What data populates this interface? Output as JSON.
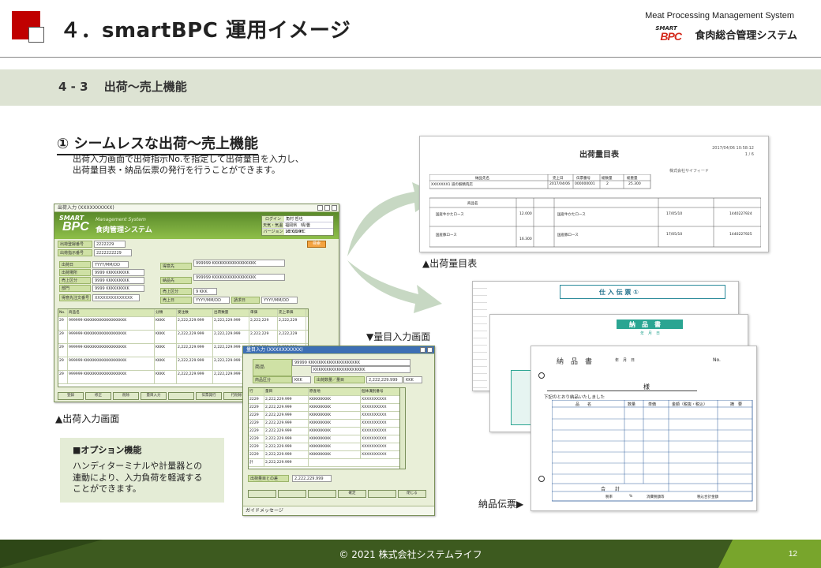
{
  "header": {
    "title": "４．smartBPC 運用イメージ",
    "system_en": "Meat Processing Management System",
    "brand_small": "SMART",
    "brand_bpc": "BPC",
    "brand_jp": "食肉総合管理システム"
  },
  "section": {
    "title": "4 - 3　 出荷〜売上機能"
  },
  "feature": {
    "title": "① シームレスな出荷〜売上機能",
    "desc": "出荷入力画面で出荷指示No.を指定して出荷量目を入力し、\n出荷量目表・納品伝票の発行を行うことができます。"
  },
  "captions": {
    "shipping_screen": "▲出荷入力画面",
    "quantity_screen": "▼量目入力画面",
    "weight_list": "▲出荷量目表",
    "delivery_slip": "納品伝票▶"
  },
  "option": {
    "title": "■オプション機能",
    "desc": "ハンディターミナルや計量器との\n連動により、入力負荷を軽減する\nことができます。"
  },
  "shipping_window": {
    "title": "出荷入力 (XXXXXXXXXX)",
    "brand_small": "SMART",
    "brand_bpc": "BPC",
    "brand_ms": "Management System",
    "brand_jp": "食肉管理システム",
    "login_rows": [
      {
        "label": "ログイン",
        "value": "角村 哲也"
      },
      {
        "label": "天気・気温",
        "value": "福岡県　晴/曇　18℃/24℃"
      },
      {
        "label": "バージョン",
        "value": "V1.00.00"
      }
    ],
    "fields": {
      "reg_no_label": "出荷登録番号",
      "reg_no_value": "2222229",
      "instr_no_label": "出荷指示番号",
      "instr_no_value": "2222222229",
      "btn_search": "検索",
      "ship_date_label": "出荷日",
      "ship_date_value": "YYYY/MM/DD",
      "dest_label": "出荷場所",
      "dest_value": "9999 KKKKKKKKK",
      "supply_label": "得意先",
      "supply_value": "999999 KKKKKKKKKKKKKKKKK",
      "sales_label": "売上区分",
      "sales_value": "9 KKK",
      "dept_label": "部門",
      "dept_value": "9999 KKKKKKKKK",
      "deliv_label": "納品先",
      "sale_date_label": "売上日",
      "sale_date_value": "YYYY/MM/DD",
      "bill_date_label": "請求日",
      "bill_date_value": "YYYY/MM/DD",
      "order_no_label": "得意先注文番号",
      "order_no_value": "XXXXXXXXXXXXXX"
    },
    "grid_headers": [
      "No.",
      "商品コード",
      "商品名",
      "分類",
      "受注数",
      "出荷数量",
      "単価",
      "売上単価"
    ],
    "grid_rows": [
      [
        "29",
        "999999 KKKKKKKKKKKKKKKKKK",
        "KKKK",
        "2,222,229.999",
        "2,222,229.999",
        "2,222,229",
        "2,222,229"
      ],
      [
        "29",
        "999999 KKKKKKKKKKKKKKKKKK",
        "KKKK",
        "2,222,229.999",
        "2,222,229.999",
        "2,222,229",
        "2,222,229"
      ],
      [
        "29",
        "999999 KKKKKKKKKKKKKKKKKK",
        "KKKK",
        "2,222,229.999",
        "2,222,229.999",
        "2,222,229",
        "2,222,229"
      ],
      [
        "29",
        "999999 KKKKKKKKKKKKKKKKKK",
        "KKKK",
        "2,222,229.999",
        "2,222,229.999",
        "2,222,229",
        "2,222,229"
      ],
      [
        "29",
        "999999 KKKKKKKKKKKKKKKKKK",
        "KKKK",
        "2,222,229.999",
        "2,222,229.999",
        "2,222,229",
        "2,222,229"
      ]
    ],
    "fkeys": [
      "登録",
      "修正",
      "削除",
      "量目入力",
      "",
      "伝票発行",
      "行削除",
      "ｲﾝﾎﾟｰﾄ",
      "ｴｸｽﾎﾟｰﾄ",
      "閉じる"
    ]
  },
  "quantity_window": {
    "title": "量目入力 (XXXXXXXXXX)",
    "product_label": "商品",
    "product_value1": "99999 KKKKKKKKKKKKKKKKKKKK",
    "product_value2": "KKKKKKKKKKKKKKKKKKKK",
    "cat_label": "商品区分",
    "cat_value": "KKK",
    "ship_qty_label": "出荷数量／量目",
    "ship_qty_value": "2,222,229.999",
    "ship_qty_unit": "KKK",
    "grid_headers": [
      "行",
      "量目",
      "原産地",
      "個体識別番号"
    ],
    "grid_rows": [
      [
        "2229",
        "2,222,229.999",
        "KKKKKKKKK",
        "XXXXXXXXXX"
      ],
      [
        "2229",
        "2,222,229.999",
        "KKKKKKKKK",
        "XXXXXXXXXX"
      ],
      [
        "2229",
        "2,222,229.999",
        "KKKKKKKKK",
        "XXXXXXXXXX"
      ],
      [
        "2229",
        "2,222,229.999",
        "KKKKKKKKK",
        "XXXXXXXXXX"
      ],
      [
        "2229",
        "2,222,229.999",
        "KKKKKKKKK",
        "XXXXXXXXXX"
      ],
      [
        "2229",
        "2,222,229.999",
        "KKKKKKKKK",
        "XXXXXXXXXX"
      ],
      [
        "2229",
        "2,222,229.999",
        "KKKKKKKKK",
        "XXXXXXXXXX"
      ],
      [
        "2229",
        "2,222,229.999",
        "KKKKKKKKK",
        "XXXXXXXXXX"
      ]
    ],
    "total_label": "計",
    "total_value": "2,222,229.999",
    "diff_label": "出荷量目との差",
    "diff_value": "2,222,229.999",
    "fkeys": [
      "",
      "",
      "",
      "確定",
      "",
      "閉じる"
    ],
    "status": "ガイドメッセージ"
  },
  "weight_list_doc": {
    "title": "出荷量目表",
    "date": "2017/04/06 10:58:12",
    "page": "1 / 6",
    "company": "株式会社サイフィード",
    "headers": [
      "納品先名",
      "売上日",
      "伝票番号",
      "総数量",
      "総重量"
    ],
    "row": [
      "XXXXXXX1 道の駅精肉店",
      "2017/04/06",
      "000000001",
      "2",
      "25.300"
    ],
    "item_headers": [
      "商品名",
      "数量",
      "重量",
      "原産地",
      "個体識別番号"
    ],
    "items": [
      [
        "国産牛かたロース",
        "12.000",
        "国産牛かたロース",
        "17/05/10",
        "1440227924"
      ],
      [
        "国産豚ロース",
        "16.300",
        "国産豚ロース",
        "17/05/10",
        "1440227925"
      ]
    ]
  },
  "slip_docs": {
    "slip1_title": "仕 入 伝 票 ①",
    "slip2_title": "納　品　書",
    "slip2_sub": "年　月　日",
    "slip3_title": "納　品　書",
    "slip3_date": "年　月　日",
    "slip3_no": "No.",
    "slip3_to": "様",
    "slip3_msg": "下記のとおり納品いたしました",
    "slip3_headers": [
      "品　　名",
      "数量",
      "単価",
      "金額（税抜・税込）",
      "摘　要"
    ],
    "slip3_total": "合　　計",
    "slip3_footer": [
      "税率",
      "%",
      "消費税額等",
      "税込合計金額"
    ]
  },
  "footer": {
    "copyright": "© 2021 株式会社システムライフ",
    "page_number": "12"
  },
  "colors": {
    "red_square": "#c00000",
    "band": "#dde3d3",
    "footer_dark": "#3d5a1f",
    "footer_light": "#78a52c",
    "screen_green": "#8fbf4a"
  }
}
